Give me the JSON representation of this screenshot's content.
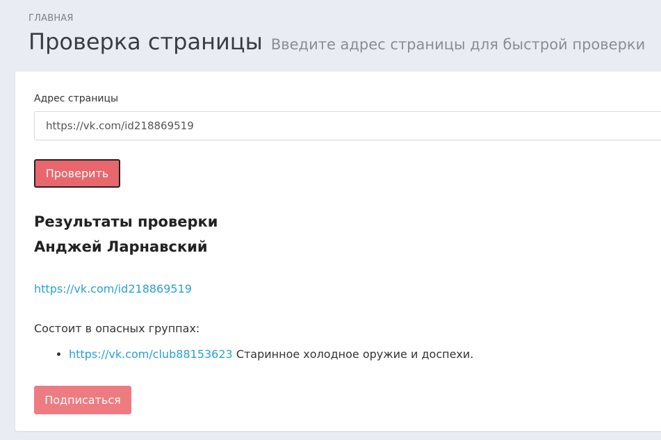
{
  "header": {
    "breadcrumb": "ГЛАВНАЯ",
    "title": "Проверка страницы",
    "subtitle": "Введите адрес страницы для быстрой проверки"
  },
  "form": {
    "label": "Адрес страницы",
    "input_value": "https://vk.com/id218869519",
    "check_button": "Проверить"
  },
  "results": {
    "title": "Результаты проверки",
    "name": "Анджей Ларнавский",
    "profile_link": "https://vk.com/id218869519",
    "danger_groups_label": "Состоит в опасных группах:",
    "groups": [
      {
        "link": "https://vk.com/club88153623",
        "description": "Старинное холодное оружие и доспехи."
      }
    ],
    "subscribe_button": "Подписаться"
  },
  "colors": {
    "accent": "#e8666c",
    "link": "#2a9fd6",
    "background": "#e9ecf3"
  }
}
